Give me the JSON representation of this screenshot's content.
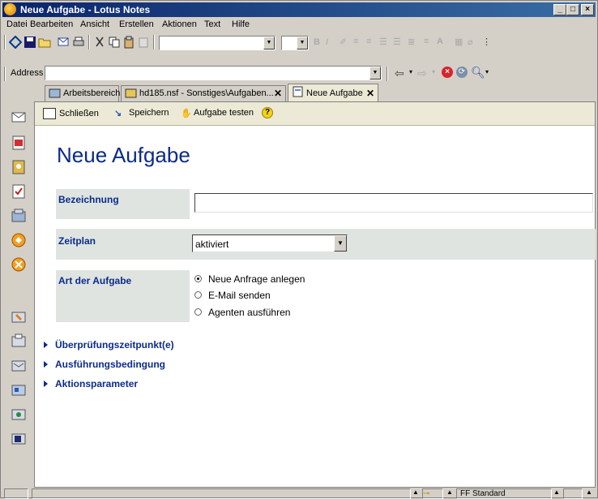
{
  "window": {
    "title": "Neue Aufgabe - Lotus Notes"
  },
  "menu": [
    "Datei",
    "Bearbeiten",
    "Ansicht",
    "Erstellen",
    "Aktionen",
    "Text",
    "Hilfe"
  ],
  "address": {
    "label": "Address",
    "value": ""
  },
  "tabs": [
    {
      "label": "Arbeitsbereich",
      "icon": "workspace-icon"
    },
    {
      "label": "hd185.nsf - Sonstiges\\Aufgaben...",
      "icon": "database-icon"
    },
    {
      "label": "Neue Aufgabe",
      "icon": "document-icon",
      "active": true
    }
  ],
  "actions": {
    "close": "Schließen",
    "save": "Speichern",
    "test": "Aufgabe testen"
  },
  "form": {
    "title": "Neue Aufgabe",
    "name_label": "Bezeichnung",
    "name_value": "",
    "schedule_label": "Zeitplan",
    "schedule_value": "aktiviert",
    "type_label": "Art der Aufgabe",
    "type_options": [
      "Neue Anfrage anlegen",
      "E-Mail senden",
      "Agenten ausführen"
    ],
    "type_selected": 0
  },
  "sections": [
    "Überprüfungszeitpunkt(e)",
    "Ausführungsbedingung",
    "Aktionsparameter"
  ],
  "status": {
    "font": "FF Standard"
  },
  "colors": {
    "accent": "#0b2b8a",
    "actionbar": "#ecead6",
    "field_bg": "#dfe4e1"
  }
}
